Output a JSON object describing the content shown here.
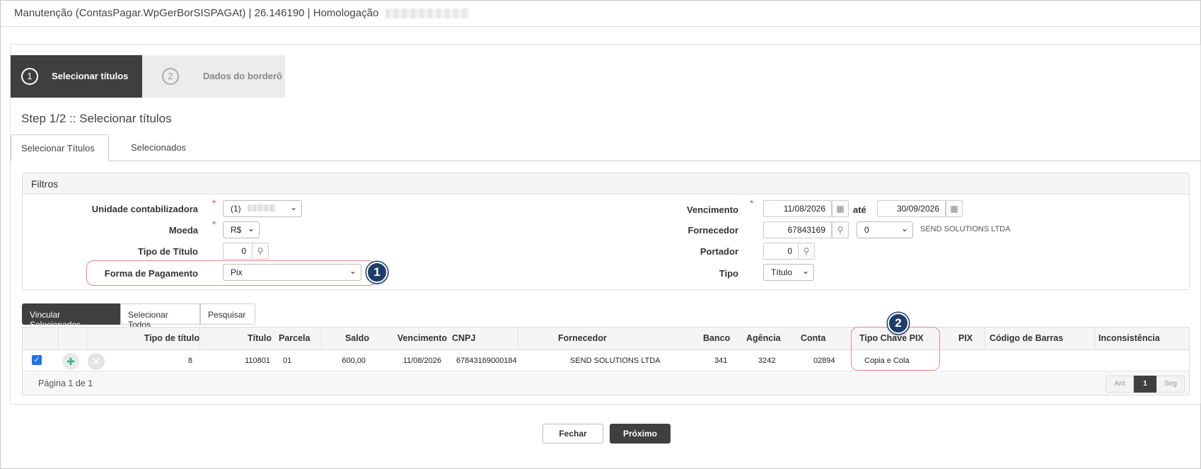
{
  "window": {
    "title": "Manutenção (ContasPagar.WpGerBorSISPAGAt) | 26.146190 | Homologação"
  },
  "wizard": {
    "steps": [
      {
        "number": "1",
        "label": "Selecionar títulos",
        "active": true
      },
      {
        "number": "2",
        "label": "Dados do borderô",
        "active": false
      }
    ],
    "step_title": "Step 1/2 :: Selecionar títulos"
  },
  "tabs": [
    {
      "label": "Selecionar Títulos",
      "active": true
    },
    {
      "label": "Selecionados",
      "active": false
    }
  ],
  "filters": {
    "header": "Filtros",
    "unidade": {
      "label": "Unidade contabilizadora",
      "value": "(1)",
      "required": true
    },
    "moeda": {
      "label": "Moeda",
      "value": "R$",
      "required": true
    },
    "tipo_titulo": {
      "label": "Tipo de Título",
      "value": "0"
    },
    "forma_pagamento": {
      "label": "Forma de Pagamento",
      "value": "Pix"
    },
    "vencimento": {
      "label": "Vencimento",
      "from": "11/08/2026",
      "to_label": "até",
      "to": "30/09/2026",
      "required": true
    },
    "fornecedor": {
      "label": "Fornecedor",
      "code": "67843169",
      "branch": "0",
      "name": "SEND SOLUTIONS LTDA"
    },
    "portador": {
      "label": "Portador",
      "value": "0"
    },
    "tipo": {
      "label": "Tipo",
      "value": "Título"
    }
  },
  "callouts": {
    "one": "1",
    "two": "2"
  },
  "actions": {
    "vincular": "Vincular Selecionados",
    "selecionar_todos": "Selecionar Todos",
    "pesquisar": "Pesquisar"
  },
  "grid": {
    "headers": {
      "tipo_titulo": "Tipo de título",
      "titulo": "Título",
      "parcela": "Parcela",
      "saldo": "Saldo",
      "vencimento": "Vencimento",
      "cnpj": "CNPJ",
      "fornecedor": "Fornecedor",
      "banco": "Banco",
      "agencia": "Agência",
      "conta": "Conta",
      "tipo_chave_pix": "Tipo Chave PIX",
      "pix": "PIX",
      "codigo_barras": "Código de Barras",
      "inconsistencia": "Inconsistência"
    },
    "rows": [
      {
        "checked": true,
        "tipo_titulo": "8",
        "titulo": "110801",
        "parcela": "01",
        "saldo": "600,00",
        "vencimento": "11/08/2026",
        "cnpj": "67843169000184",
        "fornecedor": "SEND SOLUTIONS LTDA",
        "banco": "341",
        "agencia": "3242",
        "conta": "02894",
        "tipo_chave_pix": "Copia e Cola",
        "pix": "",
        "codigo_barras": "",
        "inconsistencia": ""
      }
    ],
    "pagination": {
      "text": "Página 1 de 1",
      "prev": "Ant",
      "current": "1",
      "next": "Seg"
    }
  },
  "footer": {
    "close": "Fechar",
    "next": "Próximo"
  },
  "colors": {
    "dark": "#3f3f3f",
    "callout": "#1f3d6a",
    "highlight": "#e88888",
    "checkbox": "#1a73e8"
  }
}
